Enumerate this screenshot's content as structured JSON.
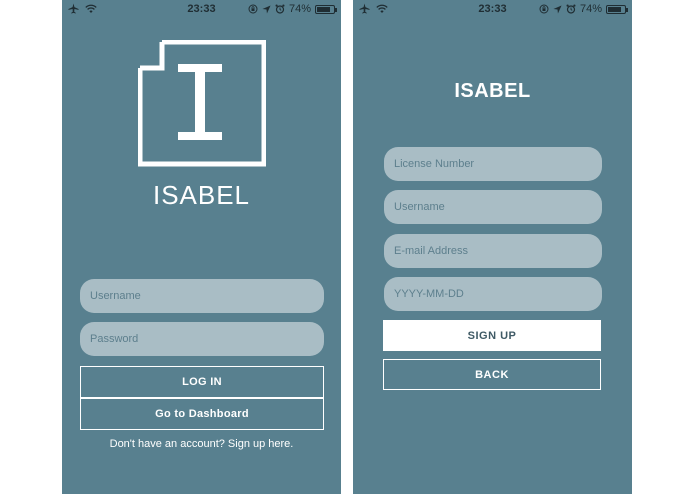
{
  "status_bar": {
    "time": "23:33",
    "battery_percent": "74%",
    "battery_level": 0.74,
    "icons": [
      "airplane-icon",
      "wifi-icon",
      "orientation-lock-icon",
      "location-icon",
      "alarm-icon",
      "battery-icon"
    ]
  },
  "login": {
    "app_name": "ISABEL",
    "logo_letter": "I",
    "username_placeholder": "Username",
    "password_placeholder": "Password",
    "login_label": "LOG IN",
    "dashboard_label": "Go to Dashboard",
    "signup_prompt": "Don't have an account? Sign up here."
  },
  "signup": {
    "app_name": "ISABEL",
    "license_placeholder": "License Number",
    "username_placeholder": "Username",
    "email_placeholder": "E-mail Address",
    "date_placeholder": "YYYY-MM-DD",
    "signup_label": "SIGN UP",
    "back_label": "BACK"
  },
  "colors": {
    "background": "#58808f",
    "field": "#a9bdc5",
    "field_text": "#5d7f8d",
    "white": "#ffffff"
  }
}
